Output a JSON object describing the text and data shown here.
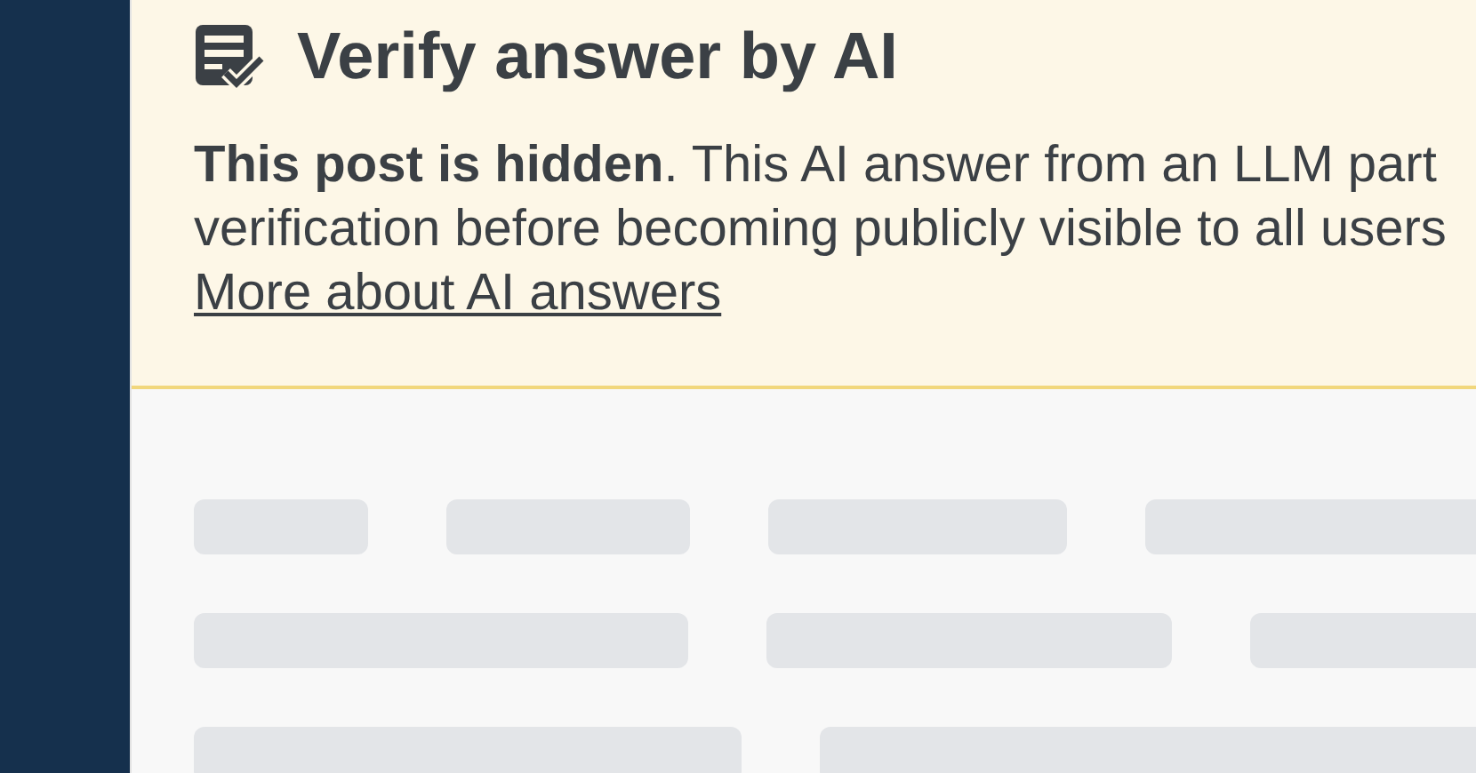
{
  "notice": {
    "title": "Verify answer by AI",
    "lines": [
      "**This post is hidden**. This AI answer from an LLM part",
      "verification before becoming publicly visible to all users"
    ],
    "link": "More about AI answers"
  },
  "loading": {
    "skeleton": true
  }
}
